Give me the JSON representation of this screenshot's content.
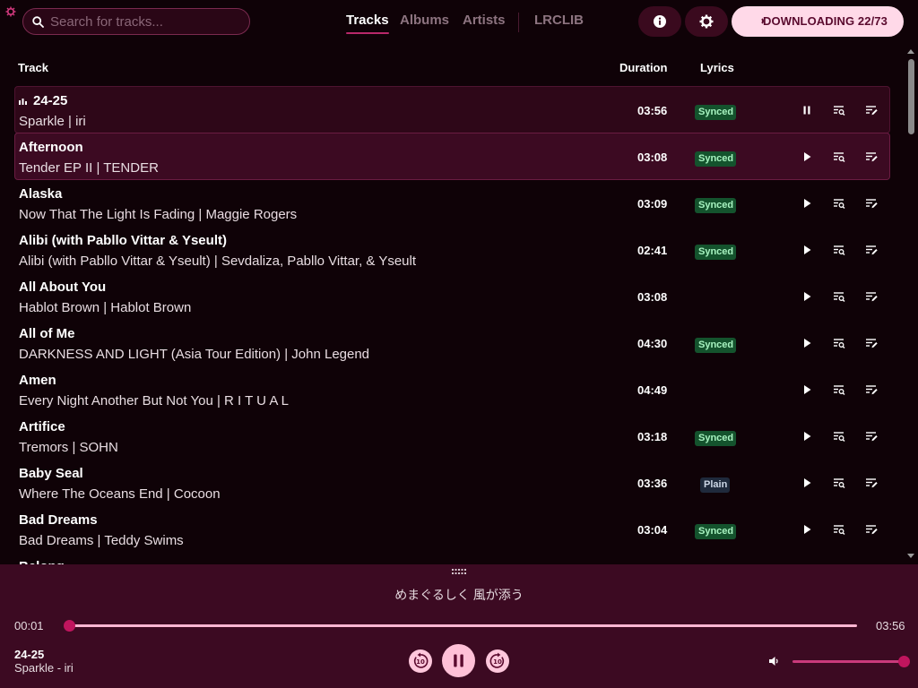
{
  "header": {
    "search_placeholder": "Search for tracks...",
    "tabs": [
      {
        "label": "Tracks",
        "active": true
      },
      {
        "label": "Albums",
        "active": false
      },
      {
        "label": "Artists",
        "active": false
      },
      {
        "label": "LRCLIB",
        "active": false
      }
    ],
    "info_icon": "info-icon",
    "settings_icon": "gear-icon",
    "download_label": "DOWNLOADING 22/73"
  },
  "columns": {
    "track": "Track",
    "duration": "Duration",
    "lyrics": "Lyrics"
  },
  "tracks": [
    {
      "title": "24-25",
      "subtitle": "Sparkle | iri",
      "duration": "03:56",
      "lyrics": "Synced",
      "playing": true
    },
    {
      "title": "Afternoon",
      "subtitle": "Tender EP II | TENDER",
      "duration": "03:08",
      "lyrics": "Synced",
      "hovered": true
    },
    {
      "title": "Alaska",
      "subtitle": "Now That The Light Is Fading | Maggie Rogers",
      "duration": "03:09",
      "lyrics": "Synced"
    },
    {
      "title": "Alibi (with Pabllo Vittar & Yseult)",
      "subtitle": "Alibi (with Pabllo Vittar & Yseult) | Sevdaliza, Pabllo Vittar, & Yseult",
      "duration": "02:41",
      "lyrics": "Synced"
    },
    {
      "title": "All About You",
      "subtitle": "Hablot Brown | Hablot Brown",
      "duration": "03:08",
      "lyrics": ""
    },
    {
      "title": "All of Me",
      "subtitle": "DARKNESS AND LIGHT (Asia Tour Edition) | John Legend",
      "duration": "04:30",
      "lyrics": "Synced"
    },
    {
      "title": "Amen",
      "subtitle": "Every Night Another But Not You | R I T U A L",
      "duration": "04:49",
      "lyrics": ""
    },
    {
      "title": "Artifice",
      "subtitle": "Tremors | SOHN",
      "duration": "03:18",
      "lyrics": "Synced"
    },
    {
      "title": "Baby Seal",
      "subtitle": "Where The Oceans End | Cocoon",
      "duration": "03:36",
      "lyrics": "Plain"
    },
    {
      "title": "Bad Dreams",
      "subtitle": "Bad Dreams | Teddy Swims",
      "duration": "03:04",
      "lyrics": "Synced"
    },
    {
      "title": "Belong",
      "subtitle": "",
      "duration": "",
      "lyrics": ""
    }
  ],
  "player": {
    "lyric_line": "めまぐるしく 風が添う",
    "current_time": "00:01",
    "total_time": "03:56",
    "progress": 0.004,
    "volume": 1.0,
    "now_title": "24-25",
    "now_subtitle": "Sparkle - iri",
    "colors": {
      "accent": "#c0155e",
      "panel": "#3c0a22",
      "background": "#0f0207"
    }
  }
}
